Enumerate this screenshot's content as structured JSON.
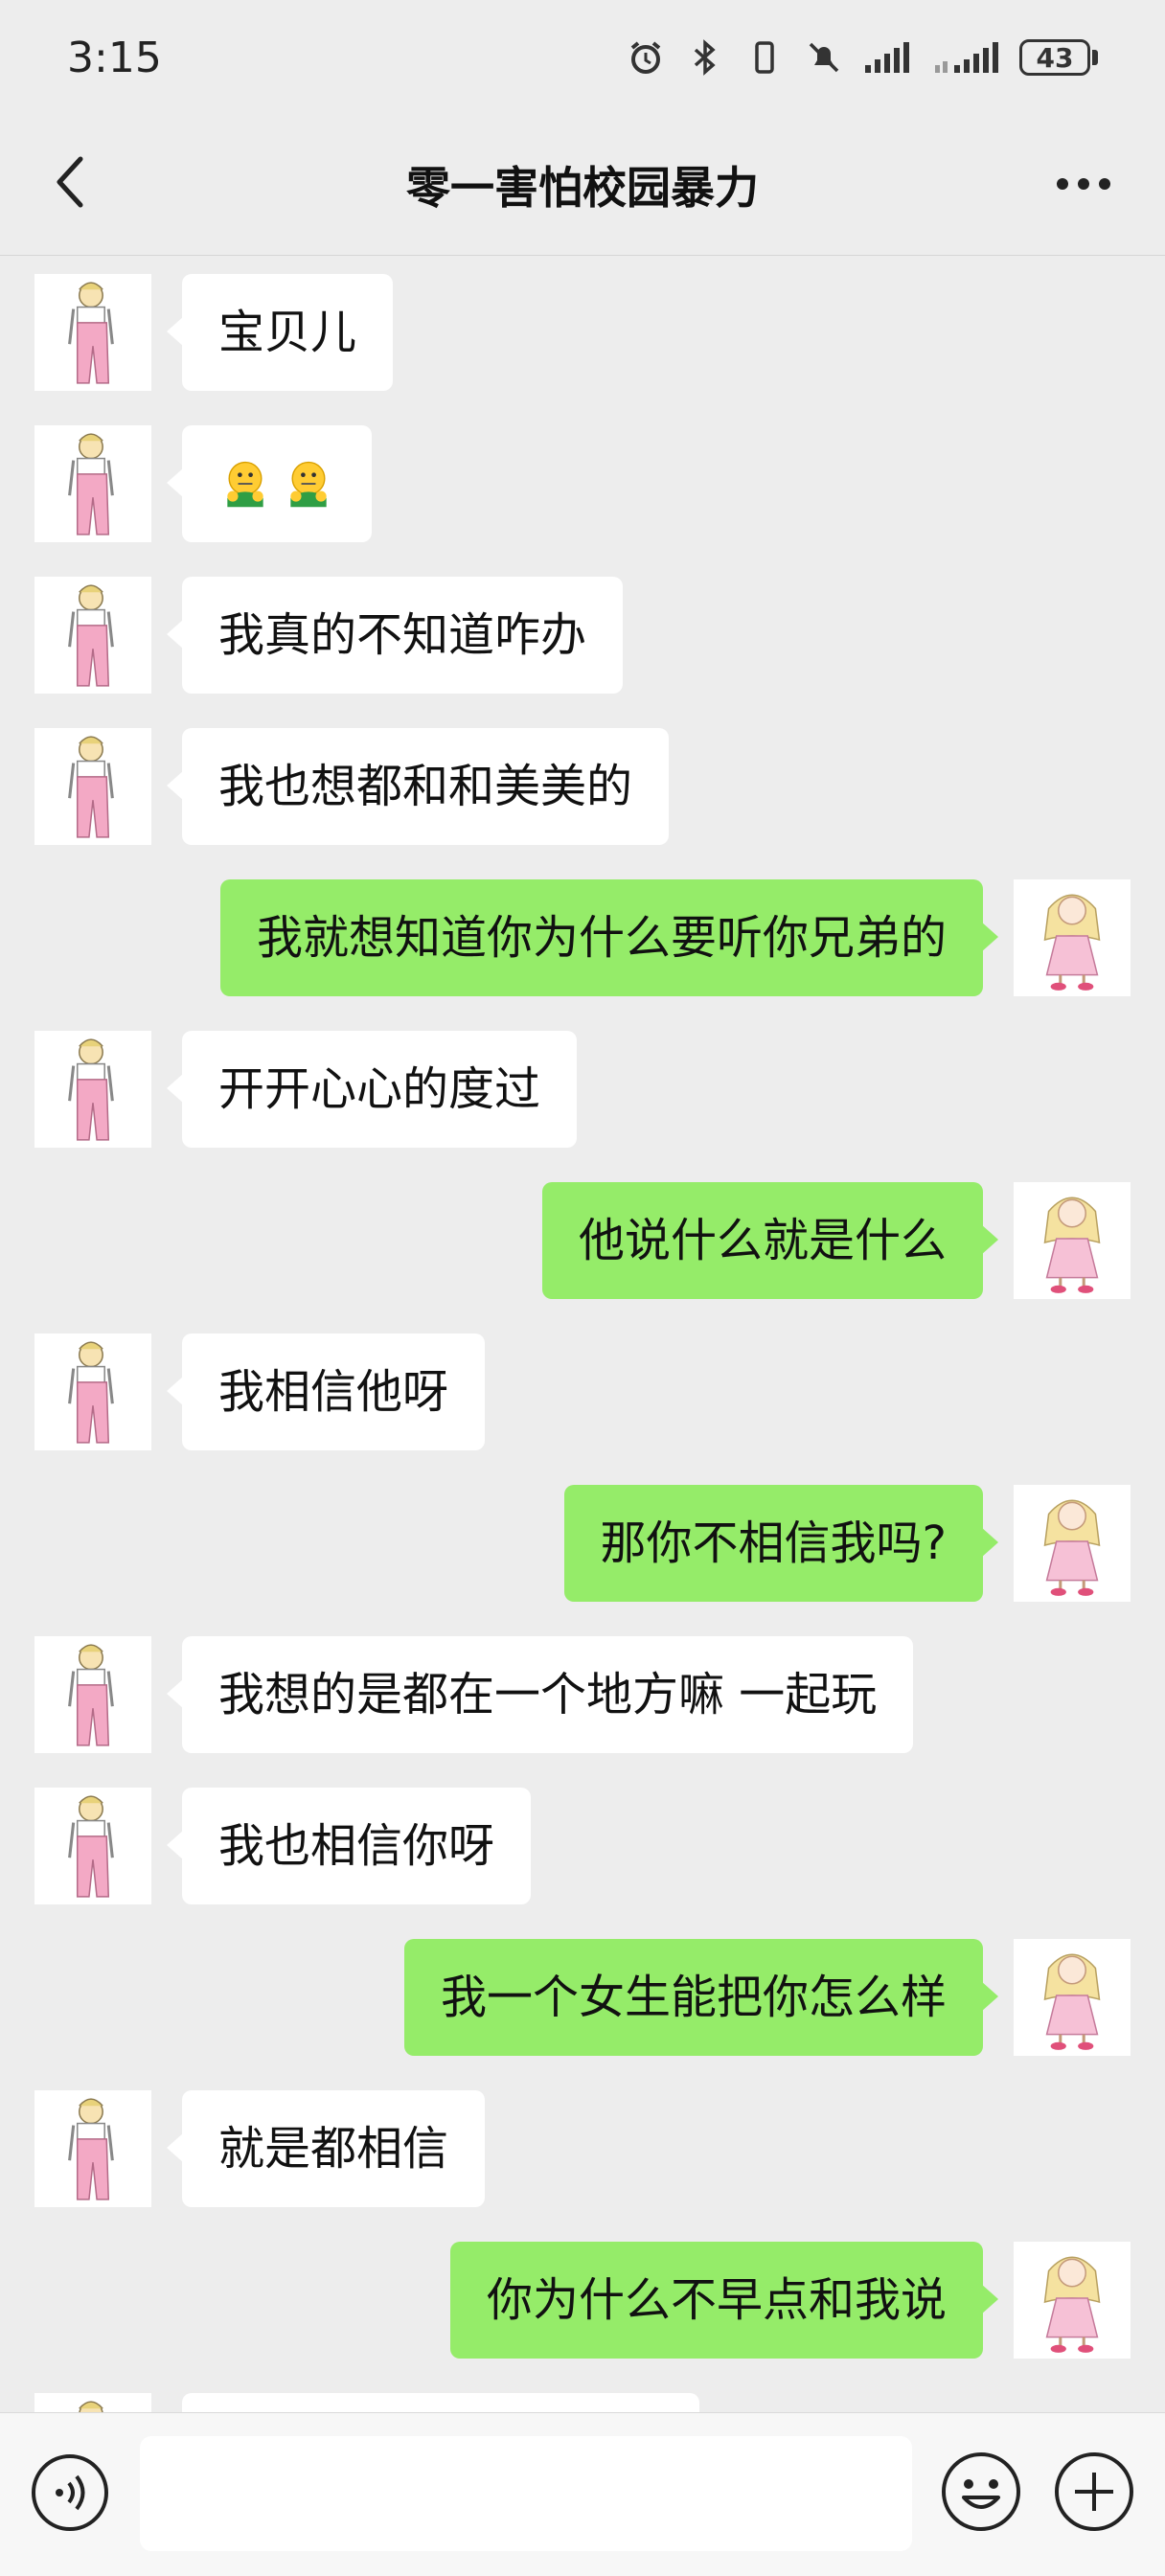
{
  "status_bar": {
    "time": "3:15",
    "battery": "43",
    "icons": [
      "alarm-icon",
      "bluetooth-icon",
      "vibrate-icon",
      "mute-icon",
      "signal-icon",
      "signal-icon-2",
      "battery-icon"
    ]
  },
  "header": {
    "title": "零一害怕校园暴力",
    "back_icon": "chevron-left-icon",
    "more_icon": "more-icon"
  },
  "colors": {
    "background": "#ededed",
    "outgoing_bubble": "#95ec69",
    "incoming_bubble": "#ffffff"
  },
  "messages": [
    {
      "side": "in",
      "text": "宝贝儿"
    },
    {
      "side": "in",
      "text": "",
      "emoji": [
        "face-with-mouth-zipped-hug-icon",
        "face-with-mouth-zipped-hug-icon"
      ]
    },
    {
      "side": "in",
      "text": "我真的不知道咋办"
    },
    {
      "side": "in",
      "text": "我也想都和和美美的"
    },
    {
      "side": "out",
      "text": "我就想知道你为什么要听你兄弟的"
    },
    {
      "side": "in",
      "text": "开开心心的度过"
    },
    {
      "side": "out",
      "text": "他说什么就是什么"
    },
    {
      "side": "in",
      "text": "我相信他呀"
    },
    {
      "side": "out",
      "text": "那你不相信我吗?"
    },
    {
      "side": "in",
      "text": "我想的是都在一个地方嘛 一起玩"
    },
    {
      "side": "in",
      "text": "我也相信你呀"
    },
    {
      "side": "out",
      "text": "我一个女生能把你怎么样"
    },
    {
      "side": "in",
      "text": "就是都相信"
    },
    {
      "side": "out",
      "text": "你为什么不早点和我说"
    }
  ],
  "input_bar": {
    "value": "",
    "icons": [
      "voice-icon",
      "emoji-icon",
      "plus-icon"
    ]
  }
}
